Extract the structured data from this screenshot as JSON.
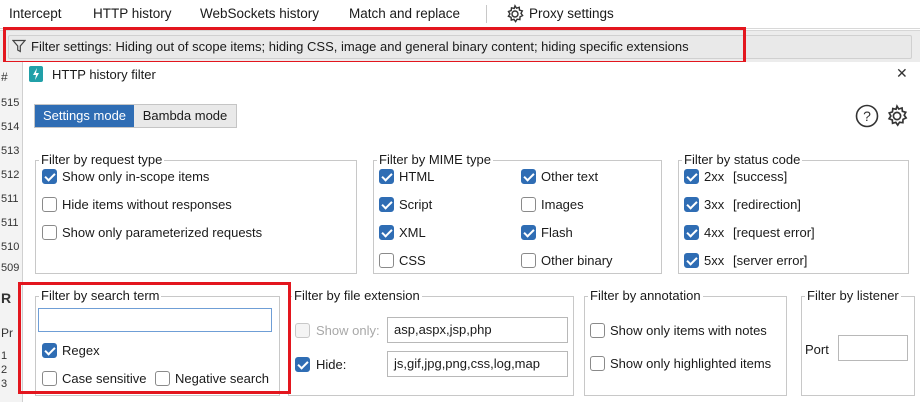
{
  "tabs": [
    {
      "label": "Intercept"
    },
    {
      "label": "HTTP history"
    },
    {
      "label": "WebSockets history"
    },
    {
      "label": "Match and replace"
    },
    {
      "label": "Proxy settings"
    }
  ],
  "filter_bar": {
    "text": "Filter settings: Hiding out of scope items; hiding CSS, image and general binary content; hiding specific extensions"
  },
  "left_strip": {
    "hash": "#",
    "rows": [
      "515",
      "514",
      "513",
      "512",
      "511",
      "511",
      "510",
      "509"
    ],
    "r_label": "R",
    "p_label": "Pr",
    "lines": [
      "1",
      "2",
      "3"
    ]
  },
  "dialog": {
    "title": "HTTP history filter",
    "close": "✕",
    "modes": {
      "settings": "Settings mode",
      "bambda": "Bambda mode",
      "active": "settings"
    },
    "request_type": {
      "legend": "Filter by request type",
      "items": [
        {
          "label": "Show only in-scope items",
          "checked": true
        },
        {
          "label": "Hide items without responses",
          "checked": false
        },
        {
          "label": "Show only parameterized requests",
          "checked": false
        }
      ]
    },
    "mime_type": {
      "legend": "Filter by MIME type",
      "items": [
        {
          "label": "HTML",
          "checked": true
        },
        {
          "label": "Script",
          "checked": true
        },
        {
          "label": "XML",
          "checked": true
        },
        {
          "label": "CSS",
          "checked": false
        },
        {
          "label": "Other text",
          "checked": true
        },
        {
          "label": "Images",
          "checked": false
        },
        {
          "label": "Flash",
          "checked": true
        },
        {
          "label": "Other binary",
          "checked": false
        }
      ]
    },
    "status_code": {
      "legend": "Filter by status code",
      "items": [
        {
          "code": "2xx",
          "desc": "[success]",
          "checked": true
        },
        {
          "code": "3xx",
          "desc": "[redirection]",
          "checked": true
        },
        {
          "code": "4xx",
          "desc": "[request error]",
          "checked": true
        },
        {
          "code": "5xx",
          "desc": "[server error]",
          "checked": true
        }
      ]
    },
    "search_term": {
      "legend": "Filter by search term",
      "value": "",
      "regex": {
        "label": "Regex",
        "checked": true
      },
      "case_sensitive": {
        "label": "Case sensitive",
        "checked": false
      },
      "negative": {
        "label": "Negative search",
        "checked": false
      }
    },
    "file_extension": {
      "legend": "Filter by file extension",
      "show_only": {
        "label": "Show only:",
        "checked": false,
        "value": "asp,aspx,jsp,php"
      },
      "hide": {
        "label": "Hide:",
        "checked": true,
        "value": "js,gif,jpg,png,css,log,map"
      }
    },
    "annotation": {
      "legend": "Filter by annotation",
      "notes": {
        "label": "Show only items with notes",
        "checked": false
      },
      "highlighted": {
        "label": "Show only highlighted items",
        "checked": false
      }
    },
    "listener": {
      "legend": "Filter by listener",
      "port_label": "Port",
      "port_value": ""
    }
  },
  "colors": {
    "accent": "#2f6db4",
    "highlight_box": "#e3161e"
  }
}
